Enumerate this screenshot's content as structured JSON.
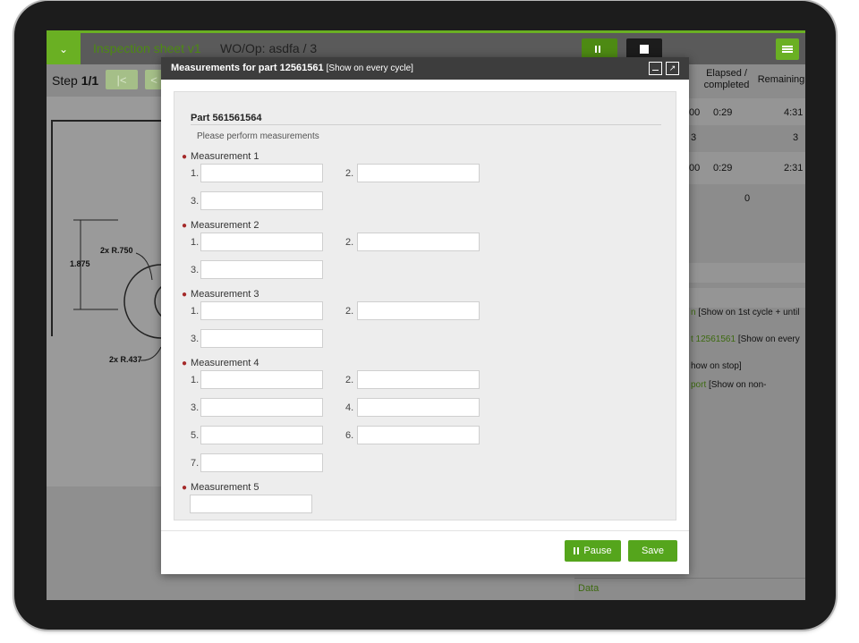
{
  "header": {
    "app_title": "Inspection sheet v1",
    "wo_op": "WO/Op: asdfa / 3"
  },
  "step": {
    "label": "Step",
    "value": "1/1"
  },
  "drawing": {
    "dims": [
      "2x R.750",
      "1.875",
      "2x R.437"
    ]
  },
  "right_panel": {
    "headers": {
      "elapsed": "Elapsed /\ncompleted",
      "remaining": "Remaining"
    },
    "rows": [
      {
        "col0": "00",
        "elapsed": "0:29",
        "remaining": "4:31"
      },
      {
        "col0": "3",
        "elapsed": "",
        "remaining": "3"
      },
      {
        "col0": "00",
        "elapsed": "0:29",
        "remaining": "2:31"
      },
      {
        "col0": "",
        "elapsed": "0",
        "remaining": ""
      }
    ],
    "list": [
      {
        "prefix": "n",
        "text": " [Show on 1st cycle + until"
      },
      {
        "prefix": "t 12561561",
        "text": " [Show on every"
      },
      {
        "prefix": "",
        "text": "how on stop]"
      },
      {
        "prefix": "port",
        "text": " [Show on non-"
      }
    ],
    "footer": "Data"
  },
  "modal": {
    "title": "Measurements for part 12561561",
    "subtitle": "[Show on every cycle]",
    "part_title": "Part 561561564",
    "instructions": "Please perform measurements",
    "measurements": [
      {
        "label": "Measurement 1",
        "fields": [
          "1.",
          "2.",
          "3."
        ]
      },
      {
        "label": "Measurement 2",
        "fields": [
          "1.",
          "2.",
          "3."
        ]
      },
      {
        "label": "Measurement 3",
        "fields": [
          "1.",
          "2.",
          "3."
        ]
      },
      {
        "label": "Measurement 4",
        "fields": [
          "1.",
          "2.",
          "3.",
          "4.",
          "5.",
          "6.",
          "7."
        ]
      },
      {
        "label": "Measurement 5",
        "fields": [
          ""
        ]
      }
    ],
    "pause_label": "Pause",
    "save_label": "Save"
  }
}
